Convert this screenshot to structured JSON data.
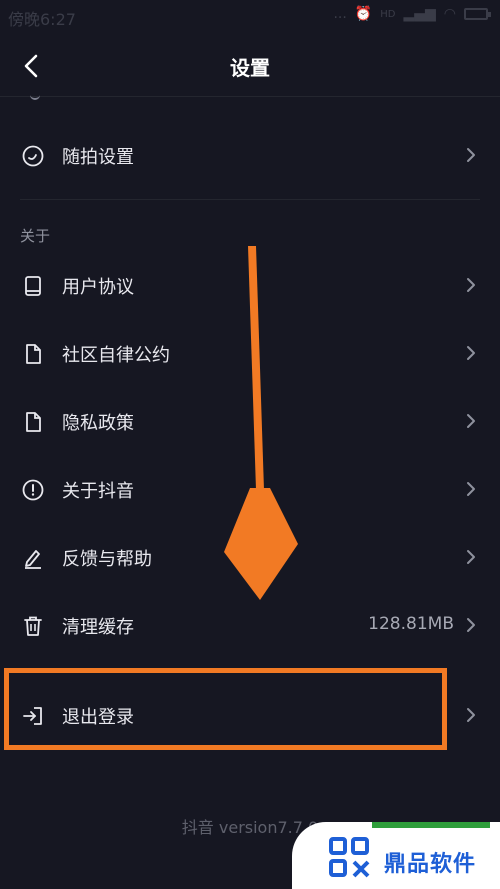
{
  "status_bar": {
    "time": "傍晚6:27",
    "dots": "...",
    "network": "HD"
  },
  "header": {
    "title": "设置"
  },
  "settings": {
    "suipai": {
      "label": "随拍设置"
    },
    "about_section": {
      "title": "关于"
    },
    "items": [
      {
        "label": "用户协议",
        "icon": "book-icon"
      },
      {
        "label": "社区自律公约",
        "icon": "document-icon"
      },
      {
        "label": "隐私政策",
        "icon": "document-icon"
      },
      {
        "label": "关于抖音",
        "icon": "info-circle-icon"
      },
      {
        "label": "反馈与帮助",
        "icon": "edit-pen-icon"
      },
      {
        "label": "清理缓存",
        "icon": "trash-icon",
        "value": "128.81MB"
      }
    ],
    "logout": {
      "label": "退出登录",
      "icon": "logout-icon"
    }
  },
  "footer": {
    "version": "抖音 version7.7.0"
  },
  "watermark": {
    "text": "鼎品软件"
  },
  "colors": {
    "background": "#161722",
    "annotation": "#f27a24",
    "text": "#e8e8ee"
  }
}
